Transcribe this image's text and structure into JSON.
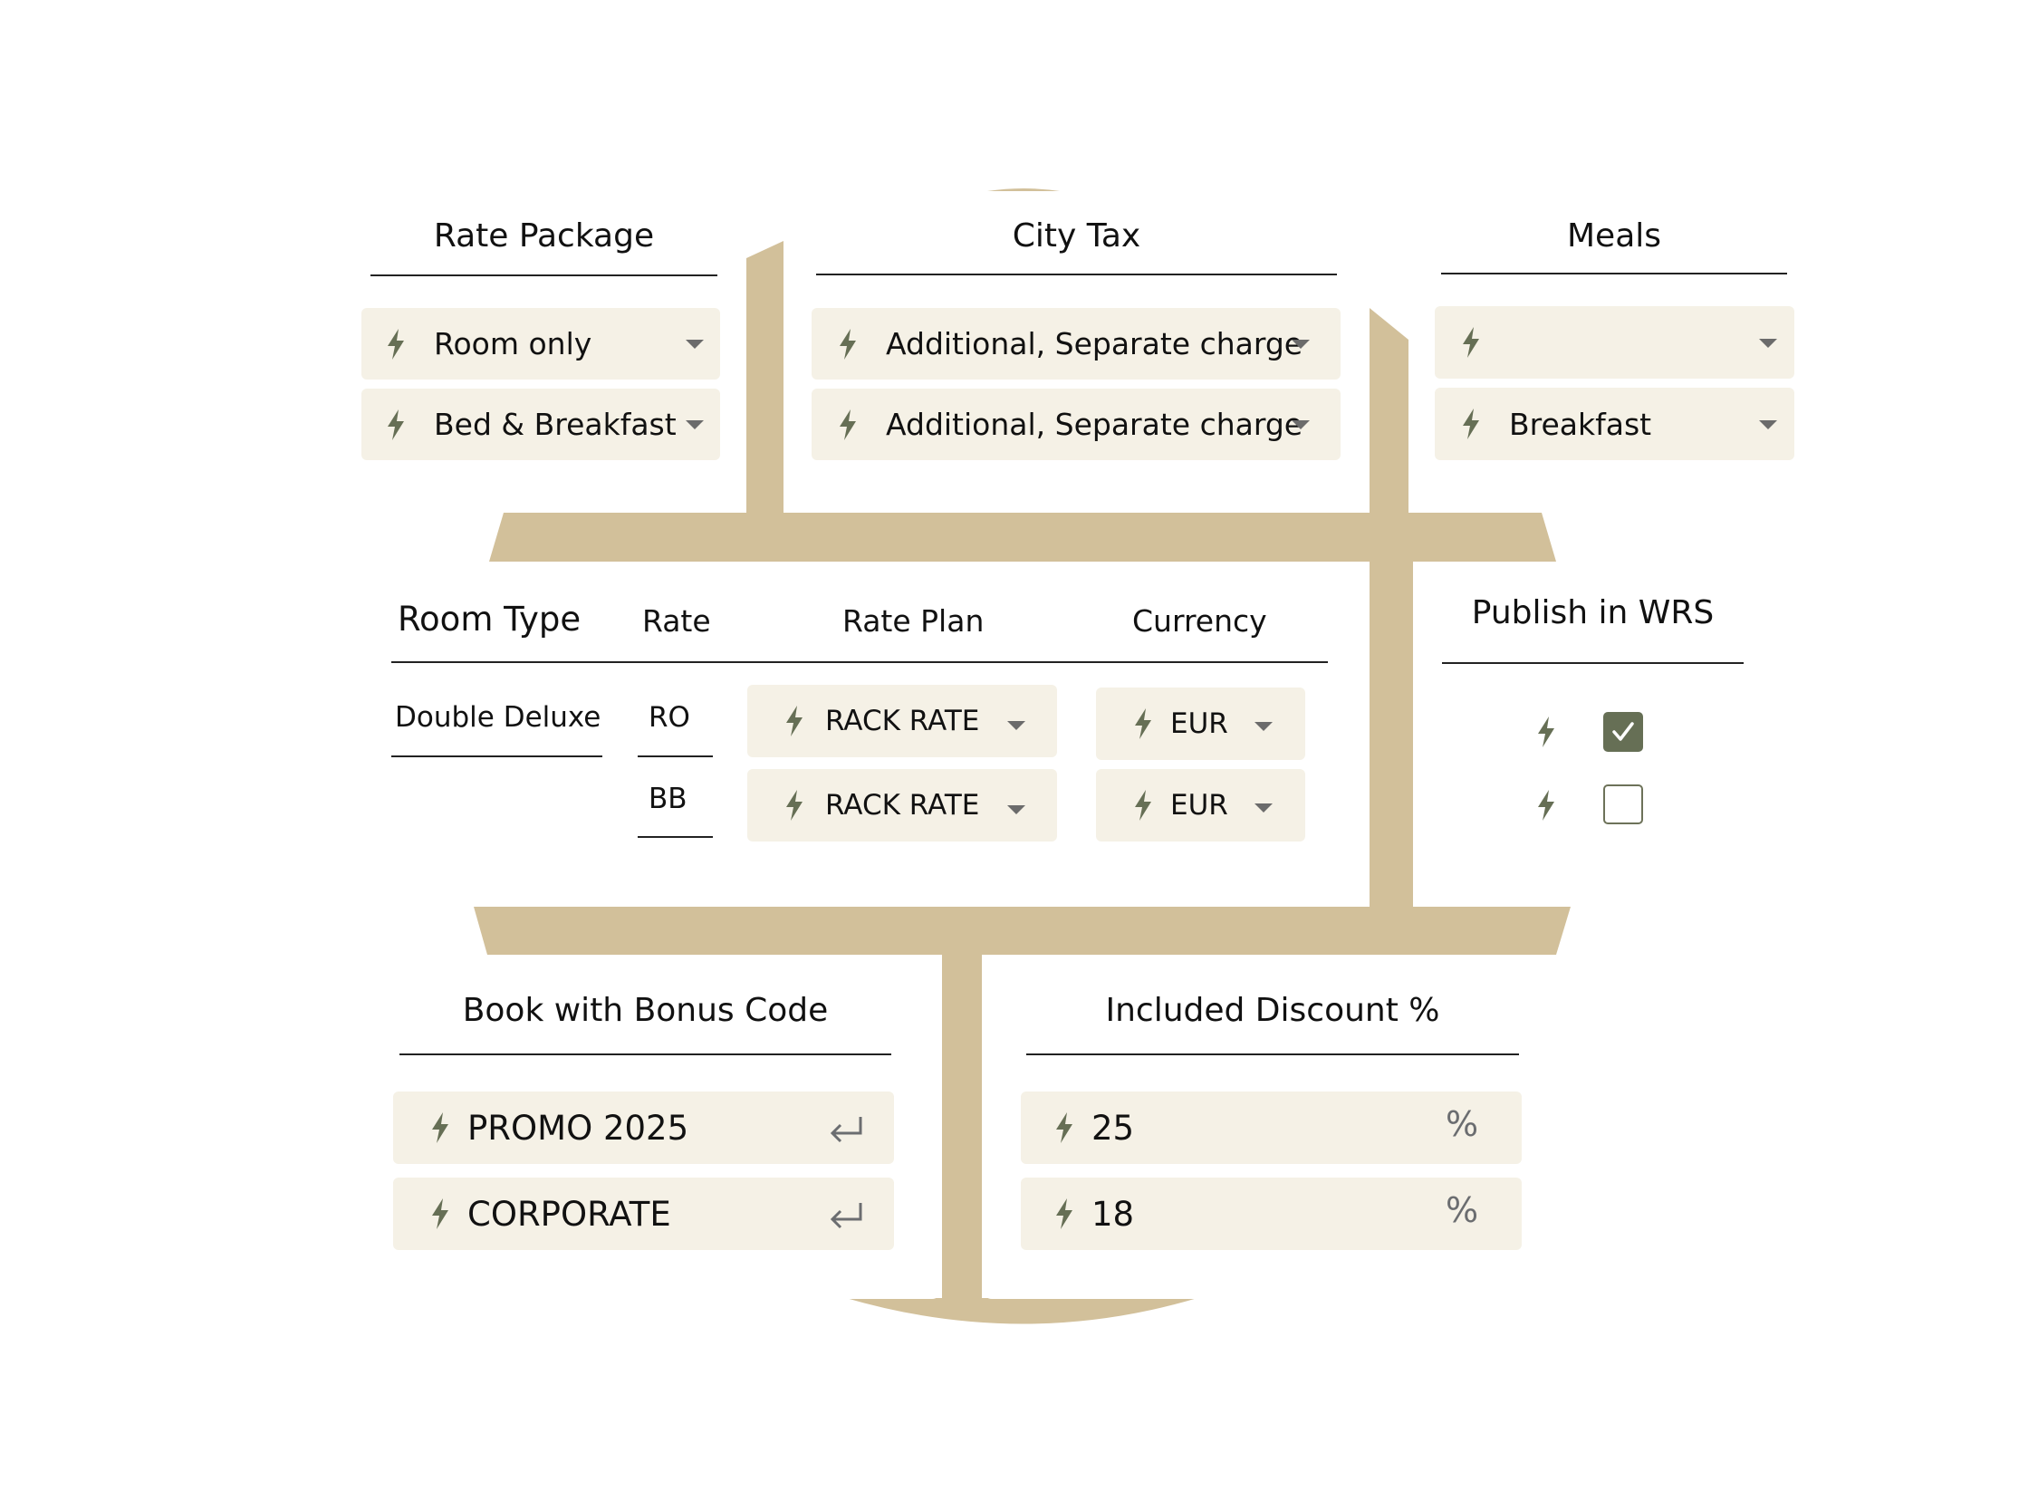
{
  "colors": {
    "frame": "#d2c09a",
    "field_bg": "#f5f1e6",
    "accent": "#666f55",
    "caret": "#6b6b6b"
  },
  "rate_package": {
    "title": "Rate Package",
    "options": [
      {
        "icon": "bolt-icon",
        "value": "Room only"
      },
      {
        "icon": "bolt-icon",
        "value": "Bed & Breakfast"
      }
    ]
  },
  "city_tax": {
    "title": "City Tax",
    "options": [
      {
        "icon": "bolt-icon",
        "value": "Additional, Separate charge"
      },
      {
        "icon": "bolt-icon",
        "value": "Additional, Separate charge"
      }
    ]
  },
  "meals": {
    "title": "Meals",
    "options": [
      {
        "icon": "bolt-icon",
        "value": ""
      },
      {
        "icon": "bolt-icon",
        "value": "Breakfast"
      }
    ]
  },
  "rates_table": {
    "headers": [
      "Room Type",
      "Rate",
      "Rate Plan",
      "Currency"
    ],
    "room_type": "Double Deluxe",
    "rows": [
      {
        "rate": "RO",
        "rate_plan": "RACK RATE",
        "currency": "EUR"
      },
      {
        "rate": "BB",
        "rate_plan": "RACK RATE",
        "currency": "EUR"
      }
    ]
  },
  "publish": {
    "title": "Publish in WRS",
    "items": [
      {
        "checked": true
      },
      {
        "checked": false
      }
    ]
  },
  "bonus_code": {
    "title": "Book with Bonus Code",
    "items": [
      {
        "value": "PROMO 2025",
        "action_icon": "enter-icon"
      },
      {
        "value": "CORPORATE",
        "action_icon": "enter-icon"
      }
    ]
  },
  "discount": {
    "title": "Included Discount %",
    "items": [
      {
        "value": "25",
        "suffix": "%"
      },
      {
        "value": "18",
        "suffix": "%"
      }
    ]
  }
}
